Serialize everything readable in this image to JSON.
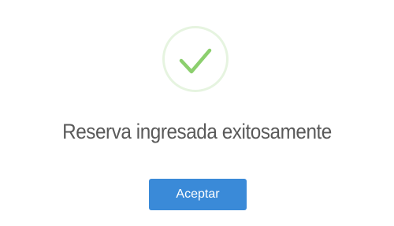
{
  "dialog": {
    "icon": "check-icon",
    "title": "Reserva ingresada exitosamente",
    "confirm_label": "Aceptar"
  },
  "colors": {
    "success": "#8ccf6e",
    "success_ring": "#e6f4e0",
    "button": "#3a8ad8",
    "title_text": "#595959"
  }
}
